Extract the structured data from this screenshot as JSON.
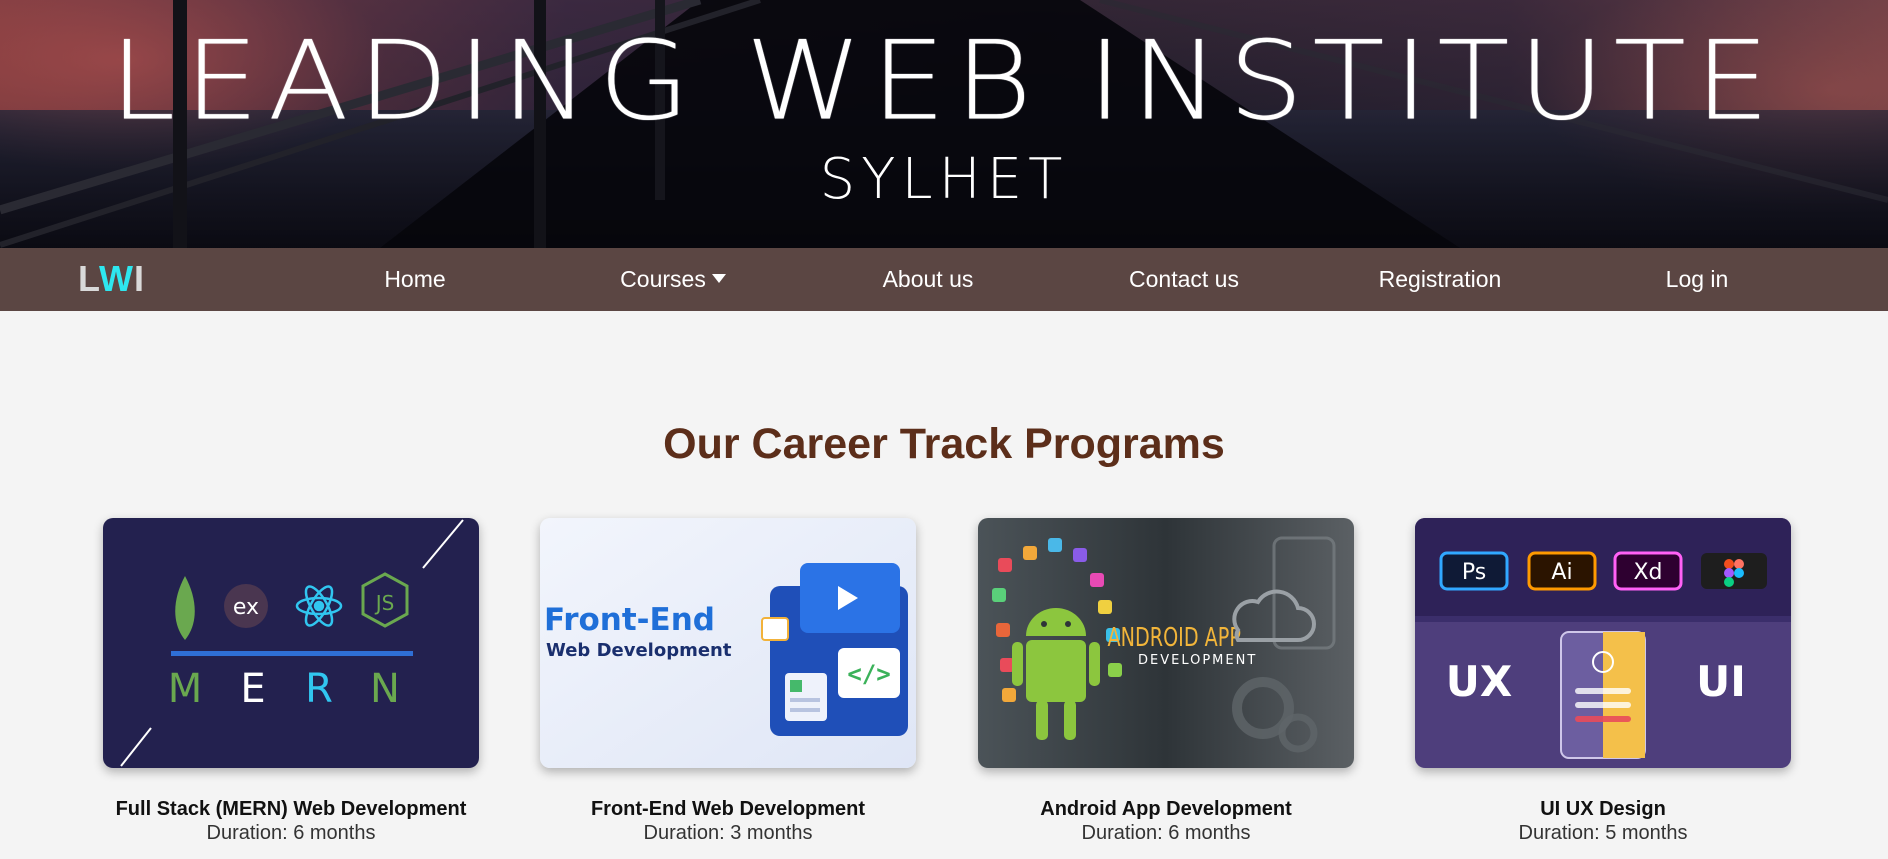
{
  "hero": {
    "title": "LEADING WEB INSTITUTE",
    "subtitle": "SYLHET"
  },
  "navbar": {
    "logo": {
      "part1": "L",
      "part2": "W",
      "part3": "I"
    },
    "items": [
      {
        "label": "Home"
      },
      {
        "label": "Courses",
        "icon": "caret-down-icon"
      },
      {
        "label": "About us"
      },
      {
        "label": "Contact us"
      },
      {
        "label": "Registration"
      },
      {
        "label": "Log in"
      }
    ]
  },
  "section": {
    "title": "Our Career Track Programs"
  },
  "courses": [
    {
      "title": "Full Stack (MERN) Web Development",
      "duration": "Duration: 6 months",
      "image_text": {
        "ex": "ex",
        "js": "JS",
        "m": "M",
        "e": "E",
        "r": "R",
        "n": "N"
      }
    },
    {
      "title": "Front-End Web Development",
      "duration": "Duration: 3 months",
      "image_text": {
        "line1": "Front-End",
        "line2": "Web Development"
      }
    },
    {
      "title": "Android App Development",
      "duration": "Duration: 6 months",
      "image_text": {
        "line1": "ANDROID APP",
        "line2": "DEVELOPMENT"
      }
    },
    {
      "title": "UI UX Design",
      "duration": "Duration: 5 months",
      "image_text": {
        "ps": "Ps",
        "ai": "Ai",
        "xd": "Xd",
        "ux": "UX",
        "ui": "UI"
      }
    }
  ],
  "colors": {
    "navbar": "#5b4643",
    "logo_accent": "#2ee7ef",
    "section_title": "#5c2e1a",
    "page_background": "#f4f4f4"
  }
}
